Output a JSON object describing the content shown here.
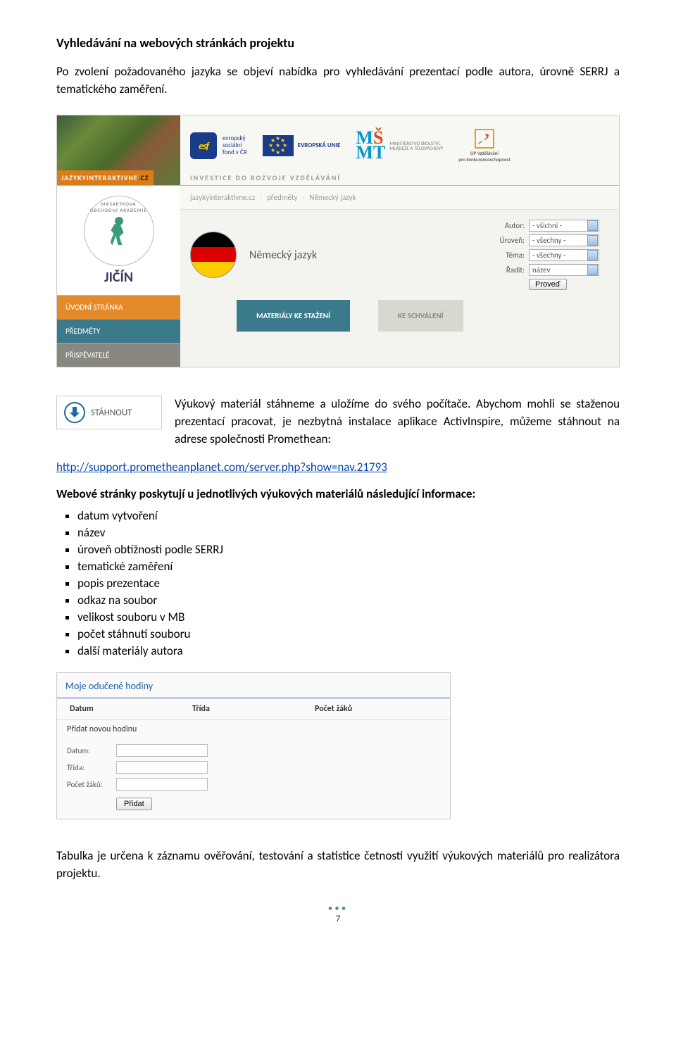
{
  "heading": "Vyhledávání na webových stránkách projektu",
  "intro": "Po zvolení požadovaného jazyka se objeví nabídka pro vyhledávání prezentací podle autora, úrovně SERRJ a tematického zaměření.",
  "shot1": {
    "site_label": "JAZYKYINTERAKTIVNE",
    "site_tld": ".CZ",
    "esf_lines": {
      "l1": "evropský",
      "l2": "sociální",
      "l3": "fond v ČR"
    },
    "eu_label": "EVROPSKÁ UNIE",
    "msmt": {
      "l1": "MINISTERSTVO ŠKOLSTVÍ,",
      "l2": "MLÁDEŽE A TĚLOVÝCHOVY"
    },
    "opvk": {
      "l1": "OP Vzdělávání",
      "l2": "pro konkurenceschopnost"
    },
    "investice": "INVESTICE DO ROZVOJE VZDĚLÁVÁNÍ",
    "jicin": "JIČÍN",
    "nav": [
      "ÚVODNÍ STRÁNKA",
      "PŘEDMĚTY",
      "PŘISPĚVATELÉ"
    ],
    "crumbs": [
      "jazykyinteraktivne.cz",
      "předměty",
      "Německý jazyk"
    ],
    "subject": "Německý jazyk",
    "filters": {
      "autor_lbl": "Autor:",
      "autor_val": "- všichni -",
      "uroven_lbl": "Úroveň:",
      "uroven_val": "- všechny -",
      "tema_lbl": "Téma:",
      "tema_val": "- všechny -",
      "radit_lbl": "Řadit:",
      "radit_val": "název",
      "submit": "Proveď"
    },
    "tabs": [
      "MATERIÁLY KE STAŽENÍ",
      "KE SCHVÁLENÍ"
    ]
  },
  "download": {
    "label": "STÁHNOUT",
    "paragraph": "Výukový materiál stáhneme a uložíme do svého počítače. Abychom mohli se staženou prezentací pracovat, je nezbytná instalace aplikace ActivInspire, můžeme stáhnout na adrese společnosti Promethean:"
  },
  "link": {
    "href": "http://support.prometheanplanet.com/server.php?show=nav.21793",
    "text": "http://support.prometheanplanet.com/server.php?show=nav.21793"
  },
  "list_intro": "Webové stránky poskytují u jednotlivých výukových materiálů následující informace:",
  "bullets": [
    "datum vytvoření",
    "název",
    "úroveň obtížnosti podle SERRJ",
    "tematické zaměření",
    "popis prezentace",
    "odkaz na soubor",
    "velikost souboru v MB",
    "počet stáhnutí souboru",
    "další materiály autora"
  ],
  "shot2": {
    "title": "Moje odučené hodiny",
    "cols": [
      "Datum",
      "Třída",
      "Počet žáků"
    ],
    "add_heading": "Přidat novou hodinu",
    "fields": {
      "datum": "Datum:",
      "trida": "Třída:",
      "pocet": "Počet žáků:"
    },
    "submit": "Přidat"
  },
  "closing": "Tabulka je určena k záznamu ověřování, testování a statistice četnosti využití výukových materiálů pro realizátora projektu.",
  "page_number": "7"
}
